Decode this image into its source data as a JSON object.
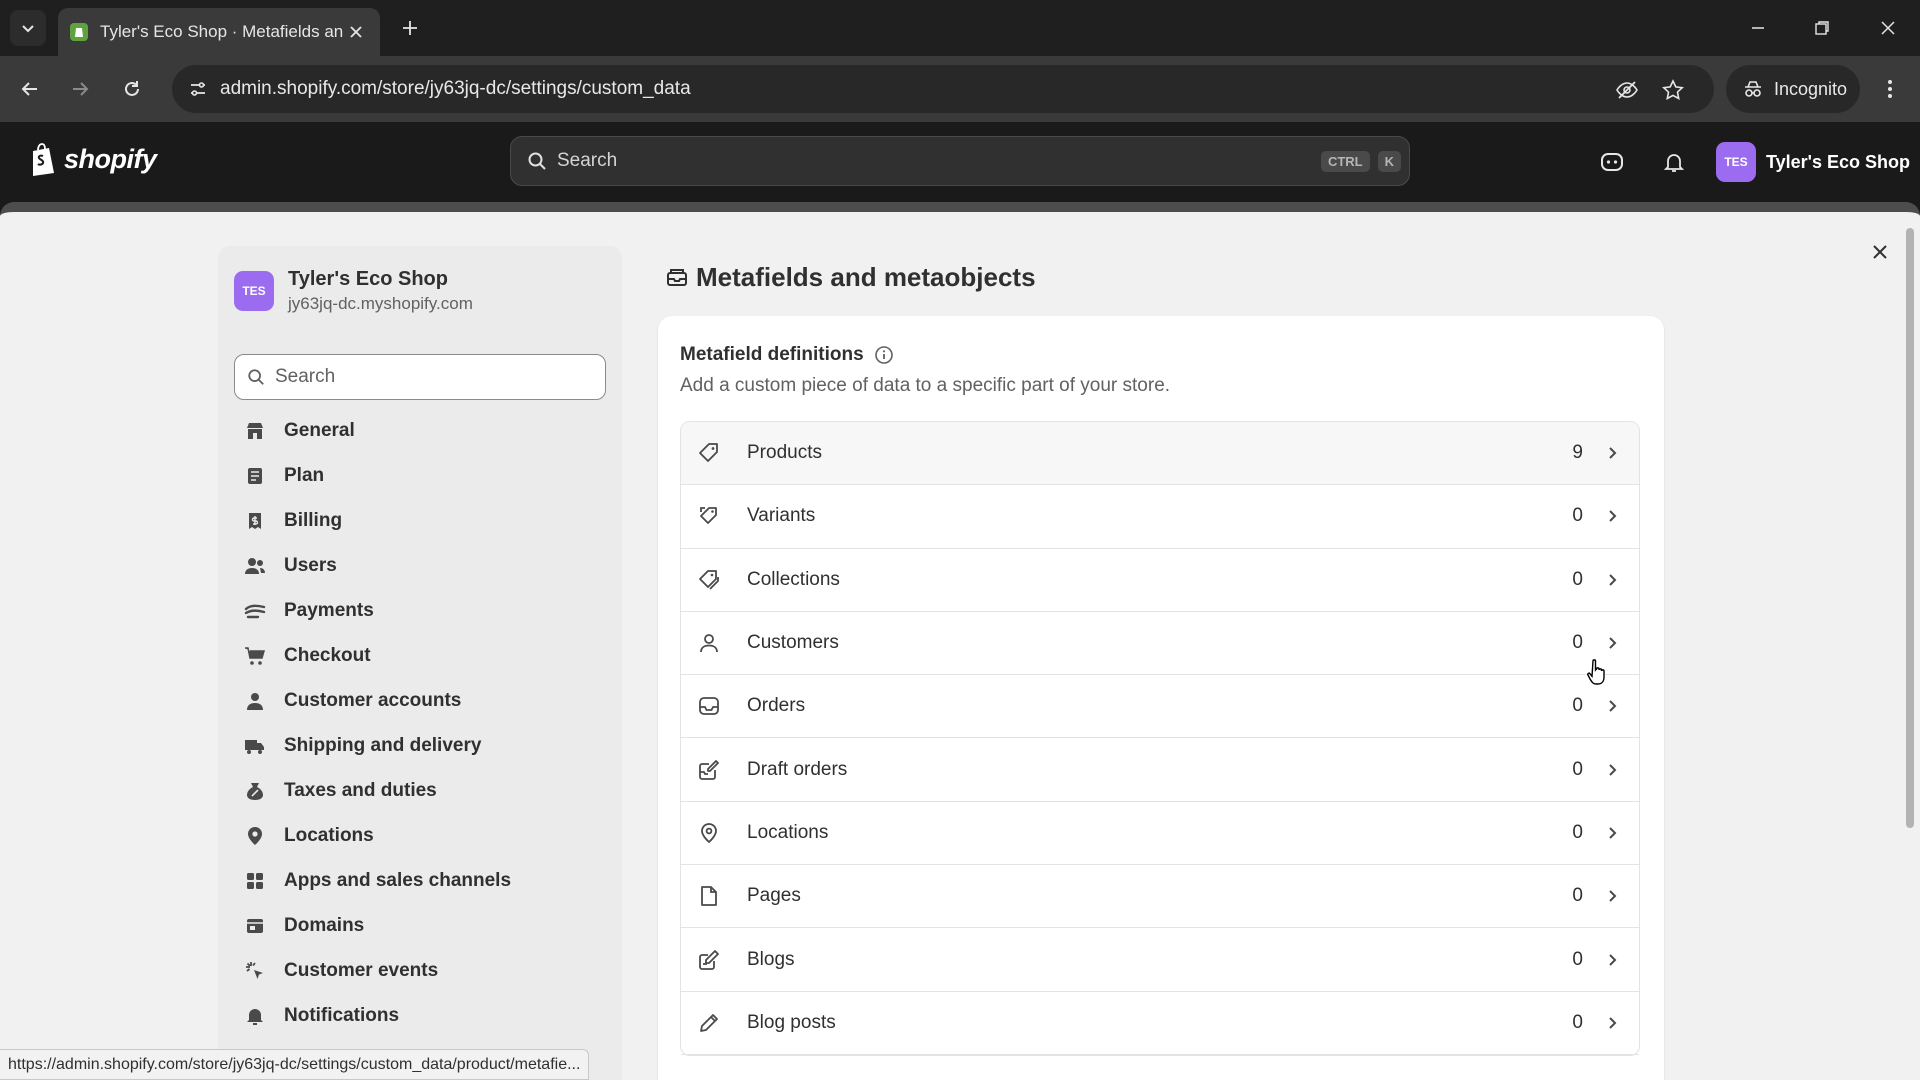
{
  "browser": {
    "tab_title": "Tyler's Eco Shop · Metafields an",
    "url": "admin.shopify.com/store/jy63jq-dc/settings/custom_data",
    "incognito_label": "Incognito",
    "status_url": "https://admin.shopify.com/store/jy63jq-dc/settings/custom_data/product/metafie..."
  },
  "topbar": {
    "logo_text": "shopify",
    "search_placeholder": "Search",
    "shortcut_key1": "CTRL",
    "shortcut_key2": "K",
    "store_initials": "TES",
    "store_name": "Tyler's Eco Shop"
  },
  "sidebar": {
    "store_initials": "TES",
    "store_name": "Tyler's Eco Shop",
    "store_domain": "jy63jq-dc.myshopify.com",
    "search_placeholder": "Search",
    "items": [
      {
        "label": "General",
        "icon": "store-icon"
      },
      {
        "label": "Plan",
        "icon": "plan-icon"
      },
      {
        "label": "Billing",
        "icon": "billing-icon"
      },
      {
        "label": "Users",
        "icon": "users-icon"
      },
      {
        "label": "Payments",
        "icon": "payments-icon"
      },
      {
        "label": "Checkout",
        "icon": "cart-icon"
      },
      {
        "label": "Customer accounts",
        "icon": "person-icon"
      },
      {
        "label": "Shipping and delivery",
        "icon": "truck-icon"
      },
      {
        "label": "Taxes and duties",
        "icon": "tax-icon"
      },
      {
        "label": "Locations",
        "icon": "location-pin-icon"
      },
      {
        "label": "Apps and sales channels",
        "icon": "apps-icon"
      },
      {
        "label": "Domains",
        "icon": "domains-icon"
      },
      {
        "label": "Customer events",
        "icon": "cursor-sparkle-icon"
      },
      {
        "label": "Notifications",
        "icon": "bell-icon"
      }
    ]
  },
  "main": {
    "page_title": "Metafields and metaobjects",
    "section_title": "Metafield definitions",
    "section_desc": "Add a custom piece of data to a specific part of your store.",
    "definitions": [
      {
        "name": "Products",
        "count": "9",
        "icon": "tag-icon"
      },
      {
        "name": "Variants",
        "count": "0",
        "icon": "variant-tag-icon"
      },
      {
        "name": "Collections",
        "count": "0",
        "icon": "collection-tag-icon"
      },
      {
        "name": "Customers",
        "count": "0",
        "icon": "person-icon"
      },
      {
        "name": "Orders",
        "count": "0",
        "icon": "inbox-icon"
      },
      {
        "name": "Draft orders",
        "count": "0",
        "icon": "draft-order-icon"
      },
      {
        "name": "Locations",
        "count": "0",
        "icon": "location-pin-icon"
      },
      {
        "name": "Pages",
        "count": "0",
        "icon": "page-icon"
      },
      {
        "name": "Blogs",
        "count": "0",
        "icon": "blog-icon"
      },
      {
        "name": "Blog posts",
        "count": "0",
        "icon": "pencil-icon"
      }
    ]
  },
  "colors": {
    "brand_avatar": "#9b6cf0",
    "chrome_dark": "#1f1f1f",
    "modal_bg": "#f1f1f1"
  }
}
